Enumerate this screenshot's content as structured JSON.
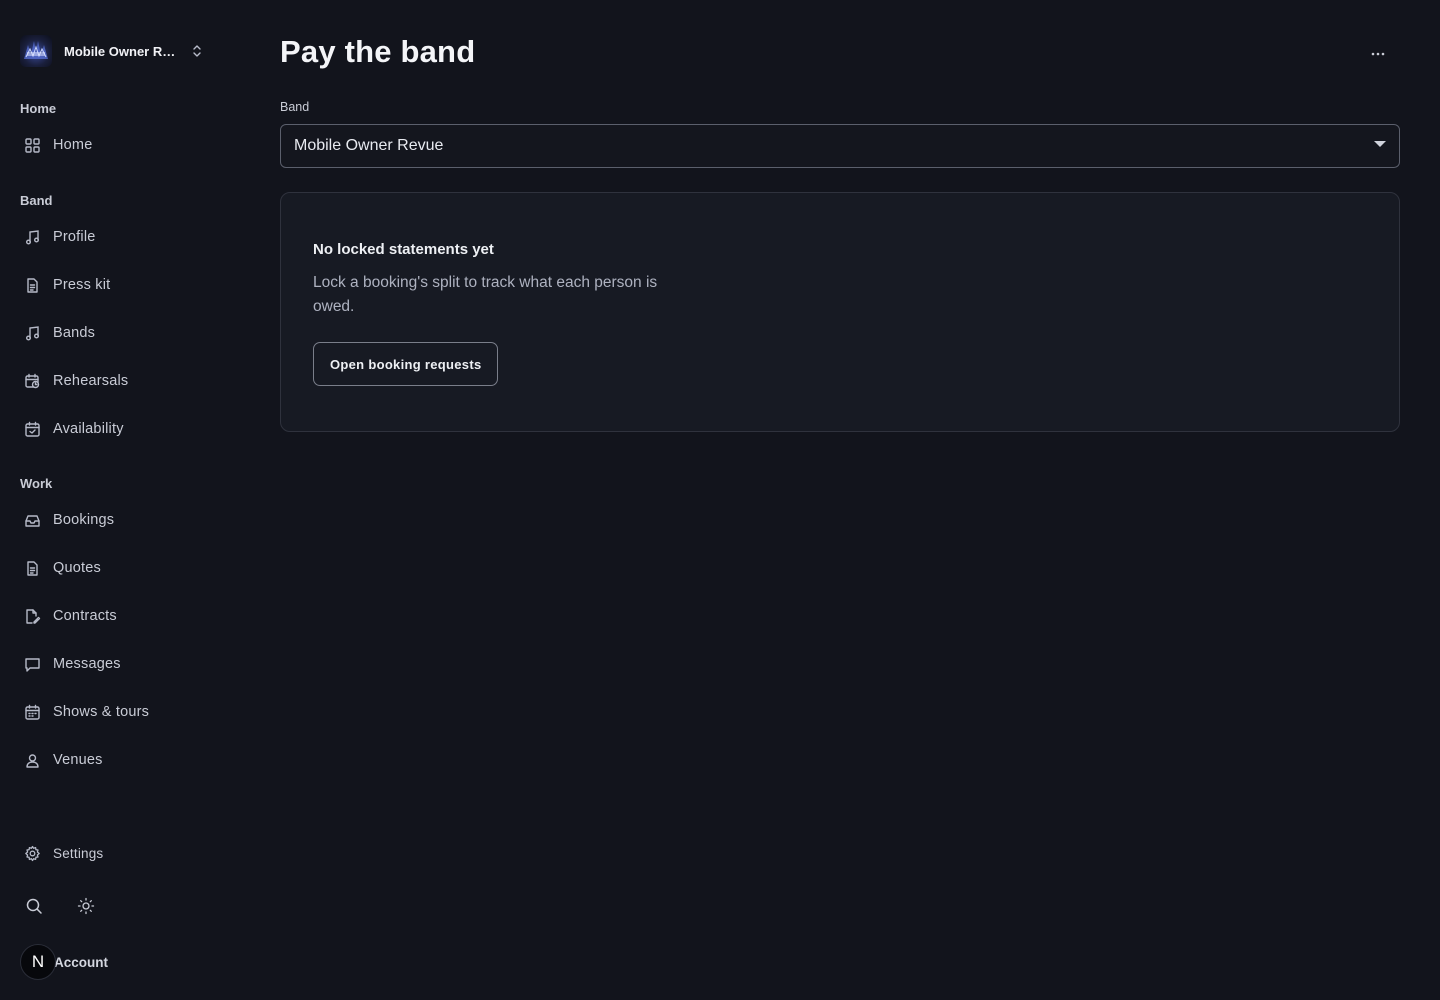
{
  "sidebar": {
    "band_switcher": {
      "name": "Mobile Owner Re..."
    },
    "sections": {
      "home": "Home",
      "band": "Band",
      "work": "Work"
    },
    "items": {
      "home": "Home",
      "profile": "Profile",
      "press_kit": "Press kit",
      "bands": "Bands",
      "rehearsals": "Rehearsals",
      "availability": "Availability",
      "bookings": "Bookings",
      "quotes": "Quotes",
      "contracts": "Contracts",
      "messages": "Messages",
      "shows_tours": "Shows & tours",
      "venues": "Venues"
    },
    "settings_label": "Settings",
    "account": {
      "initial": "N",
      "label": "Account"
    }
  },
  "main": {
    "title": "Pay the band",
    "band_field": {
      "label": "Band",
      "selected": "Mobile Owner Revue"
    },
    "empty_state": {
      "title": "No locked statements yet",
      "description": "Lock a booking's split to track what each person is owed.",
      "button_label": "Open booking requests"
    }
  },
  "colors": {
    "background": "#12141c",
    "card": "#171a23",
    "text_primary": "#f4f5f8",
    "text_muted": "#aeb2c0"
  }
}
